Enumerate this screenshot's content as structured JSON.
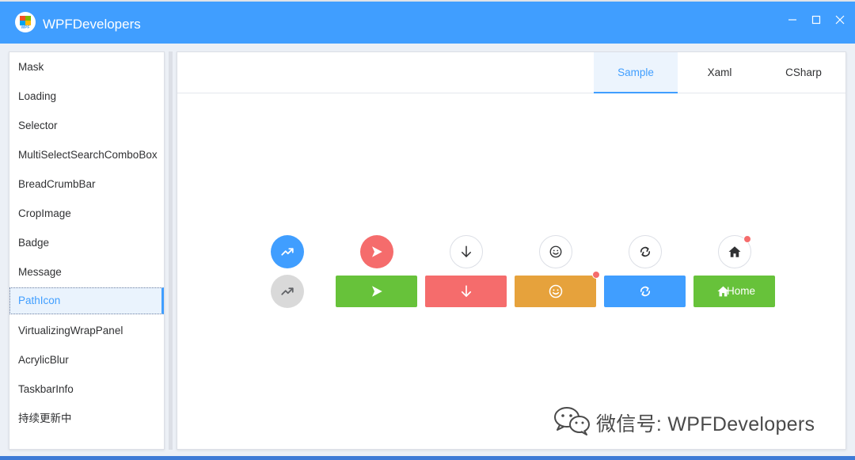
{
  "window": {
    "title": "WPFDevelopers",
    "logo_text": "WPF",
    "colors": {
      "titlebar": "#409eff",
      "accent": "#409eff"
    }
  },
  "sidebar": {
    "items": [
      {
        "label": "Mask"
      },
      {
        "label": "Loading"
      },
      {
        "label": "Selector"
      },
      {
        "label": "MultiSelectSearchComboBox"
      },
      {
        "label": "BreadCrumbBar"
      },
      {
        "label": "CropImage"
      },
      {
        "label": "Badge"
      },
      {
        "label": "Message"
      },
      {
        "label": "PathIcon",
        "selected": true
      },
      {
        "label": "VirtualizingWrapPanel"
      },
      {
        "label": "AcrylicBlur"
      },
      {
        "label": "TaskbarInfo"
      },
      {
        "label": "持续更新中"
      }
    ]
  },
  "tabs": [
    {
      "label": "Sample",
      "active": true
    },
    {
      "label": "Xaml"
    },
    {
      "label": "CSharp"
    }
  ],
  "sample": {
    "circle_icons": [
      {
        "icon": "trending-up-icon",
        "style": "filled",
        "color": "#409eff"
      },
      {
        "icon": "play-icon",
        "style": "filled",
        "color": "#f56c6c"
      },
      {
        "icon": "arrow-down-icon",
        "style": "outline"
      },
      {
        "icon": "smile-icon",
        "style": "outline"
      },
      {
        "icon": "refresh-icon",
        "style": "outline"
      },
      {
        "icon": "home-icon",
        "style": "outline",
        "badge": true
      },
      {
        "icon": "trending-up-icon",
        "style": "disabled",
        "color": "#d9d9d9"
      }
    ],
    "buttons": [
      {
        "icon": "play-icon",
        "color": "#67c23a"
      },
      {
        "icon": "arrow-down-icon",
        "color": "#f56c6c"
      },
      {
        "icon": "smile-icon",
        "color": "#e6a23c",
        "badge": true
      },
      {
        "icon": "refresh-icon",
        "color": "#409eff"
      },
      {
        "icon": "home-icon",
        "color": "#67c23a",
        "label": "Home"
      }
    ]
  },
  "watermark": {
    "text": "微信号: WPFDevelopers"
  }
}
